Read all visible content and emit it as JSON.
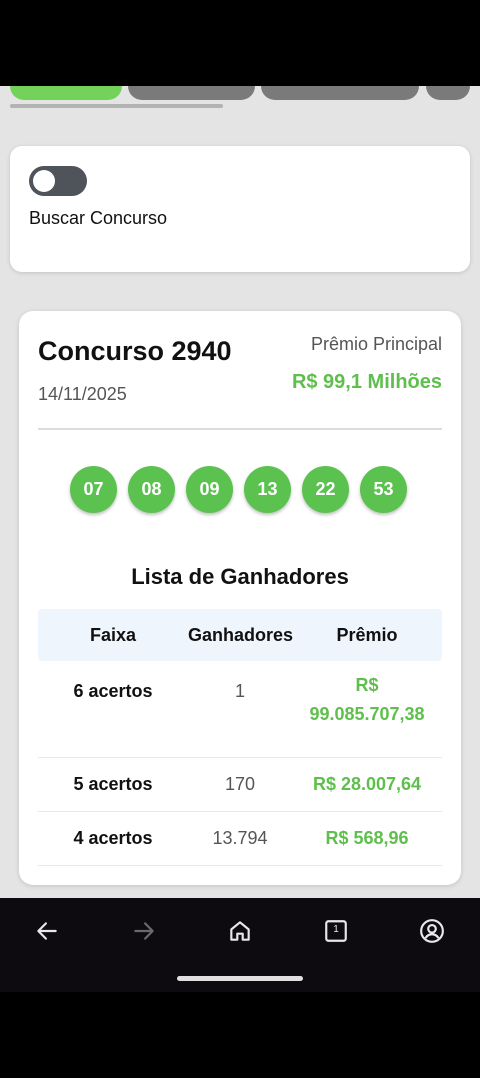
{
  "search": {
    "label": "Buscar Concurso",
    "toggle_on": false
  },
  "contest": {
    "title": "Concurso 2940",
    "date": "14/11/2025",
    "prize_label": "Prêmio Principal",
    "prize_value": "R$ 99,1 Milhões"
  },
  "numbers": [
    "07",
    "08",
    "09",
    "13",
    "22",
    "53"
  ],
  "winners": {
    "title": "Lista de Ganhadores",
    "headers": {
      "tier": "Faixa",
      "winners": "Ganhadores",
      "prize": "Prêmio"
    },
    "rows": [
      {
        "tier": "6 acertos",
        "winners": "1",
        "prize_line1": "R$",
        "prize_line2": "99.085.707,38"
      },
      {
        "tier": "5 acertos",
        "winners": "170",
        "prize": "R$ 28.007,64"
      },
      {
        "tier": "4 acertos",
        "winners": "13.794",
        "prize": "R$ 568,96"
      }
    ]
  },
  "colors": {
    "accent_green": "#5fbf4d",
    "ball_green": "#5cc24f",
    "header_bg": "#eef5fd"
  },
  "nav_icons": [
    "back-arrow-icon",
    "forward-arrow-icon",
    "home-icon",
    "tabs-icon",
    "account-icon"
  ],
  "tab_count_label": "1"
}
